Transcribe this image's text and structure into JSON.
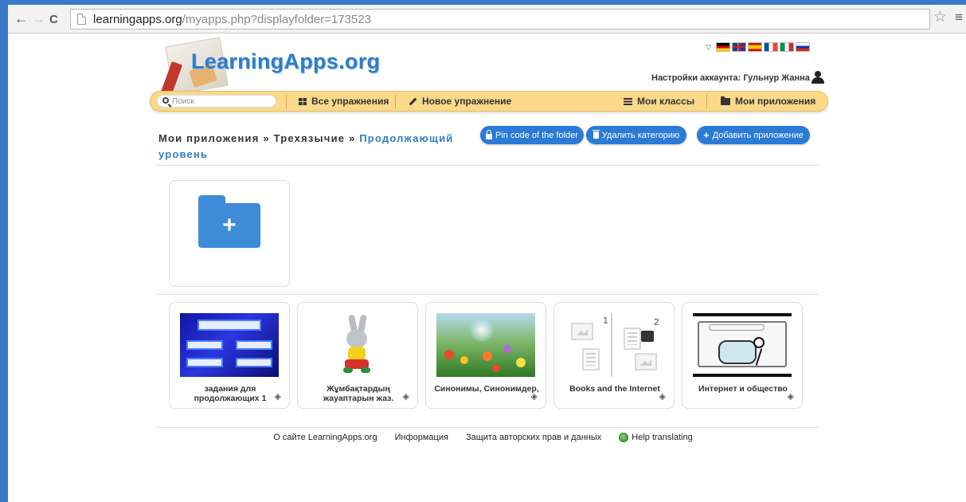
{
  "browser": {
    "url_domain": "learningapps.org",
    "url_path": "/myapps.php?displayfolder=173523",
    "back_icon": "←",
    "forward_icon": "→",
    "reload_icon": "C",
    "star_icon": "☆",
    "menu_icon": "≡"
  },
  "header": {
    "logo_text": "LearningApps.org",
    "languages": [
      "de",
      "en",
      "es",
      "fr",
      "it",
      "ru"
    ],
    "account_label": "Настройки аккаунта: Гульнур Жанна"
  },
  "search": {
    "placeholder": "Поиск"
  },
  "nav": {
    "all_exercises": "Все упражнения",
    "new_exercise": "Новое упражнение",
    "my_classes": "Мои классы",
    "my_apps": "Мои приложения"
  },
  "breadcrumb": {
    "root": "Мои приложения",
    "separator": " » ",
    "parent": "Трехязычие",
    "current": "Продолжающий уровень"
  },
  "actions": {
    "pin_code": "Pin code of the folder",
    "delete_category": "Удалить категорию",
    "add_app": "Добавить приложение"
  },
  "new_folder": {
    "icon": "folder-plus-icon"
  },
  "apps": [
    {
      "title": "задания для продолжающих 1",
      "thumb": "blue-board"
    },
    {
      "title": "Жұмбақтардың жауаптарын жаз.",
      "thumb": "bunny"
    },
    {
      "title": "Синонимы, Синонимдер,",
      "thumb": "flowers"
    },
    {
      "title": "Books and the Internet",
      "thumb": "media-icons"
    },
    {
      "title": "Интернет и общество",
      "thumb": "internet-sketch"
    }
  ],
  "footer": {
    "about": "О сайте LearningApps.org",
    "info": "Информация",
    "privacy": "Защита авторских прав и данных",
    "help": "Help translating"
  },
  "colors": {
    "accent": "#2a7ad6",
    "navbar": "#fbd98a",
    "logo": "#2f7cc7"
  }
}
